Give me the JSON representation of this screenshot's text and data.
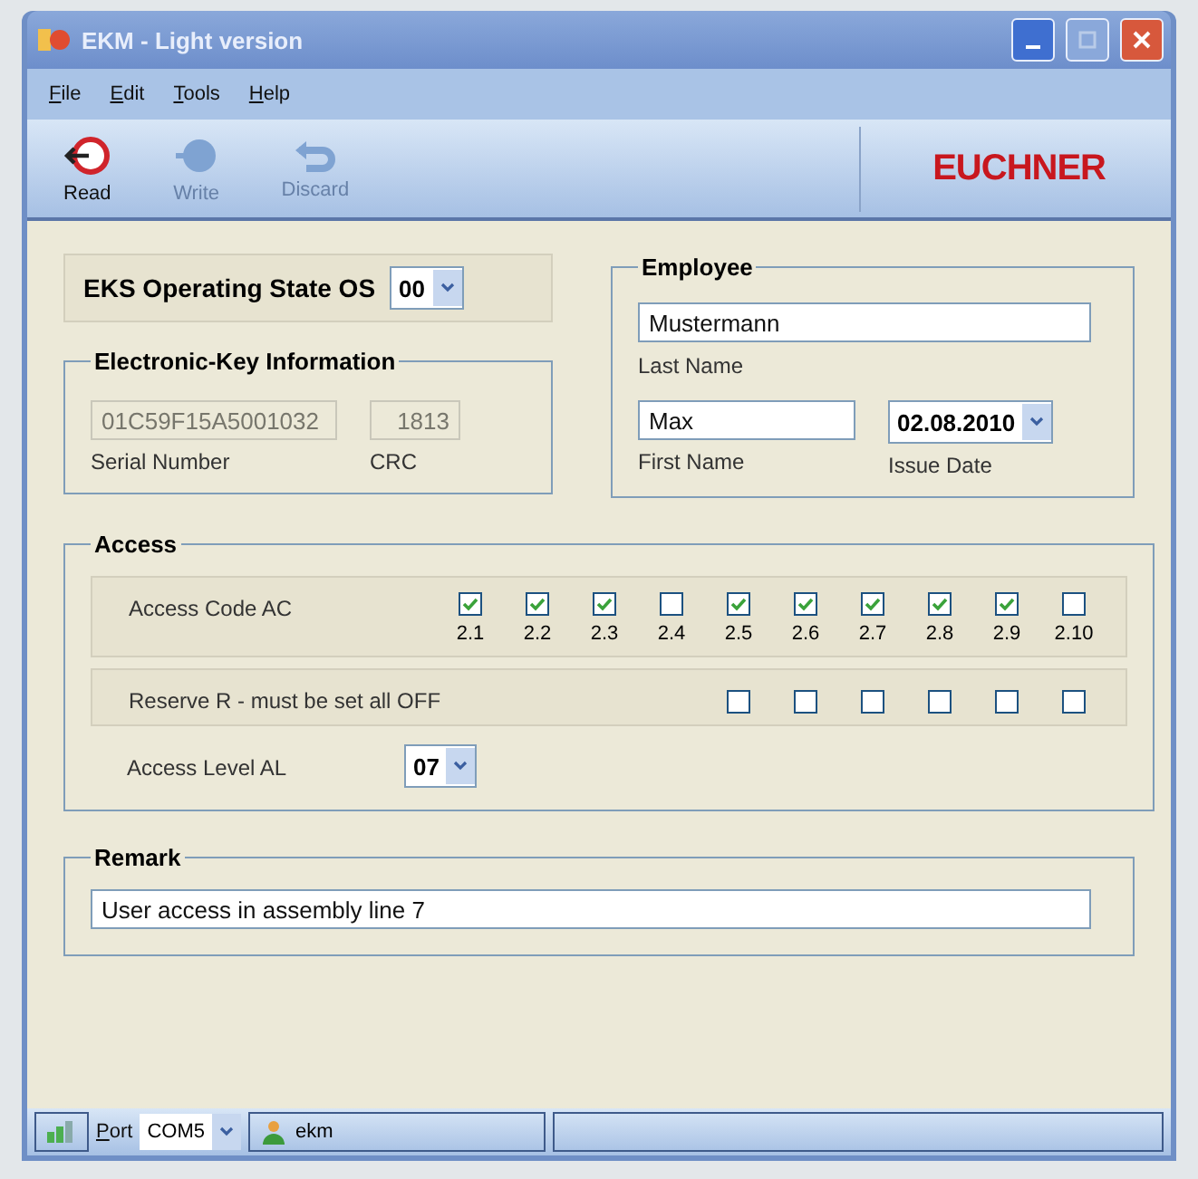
{
  "window": {
    "title": "EKM - Light version"
  },
  "menu": [
    {
      "label": "File"
    },
    {
      "label": "Edit"
    },
    {
      "label": "Tools"
    },
    {
      "label": "Help"
    }
  ],
  "toolbar": {
    "buttons": [
      {
        "kind": "read",
        "label": "Read",
        "disabled": false
      },
      {
        "kind": "write",
        "label": "Write",
        "disabled": true
      },
      {
        "kind": "discard",
        "label": "Discard",
        "disabled": true
      }
    ],
    "logo": "EUCHNER"
  },
  "operating_state": {
    "label": "EKS Operating State OS",
    "value": "00"
  },
  "key_info": {
    "title": "Electronic-Key Information",
    "serial": {
      "value": "01C59F15A5001032",
      "label": "Serial Number"
    },
    "crc": {
      "value": "1813",
      "label": "CRC"
    }
  },
  "employee": {
    "title": "Employee",
    "last_name": {
      "value": "Mustermann",
      "label": "Last Name"
    },
    "first_name": {
      "value": "Max",
      "label": "First Name"
    },
    "issue_date": {
      "value": "02.08.2010",
      "label": "Issue Date"
    }
  },
  "access": {
    "title": "Access",
    "code": {
      "label": "Access Code AC",
      "items": [
        {
          "label": "2.1",
          "checked": true
        },
        {
          "label": "2.2",
          "checked": true
        },
        {
          "label": "2.3",
          "checked": true
        },
        {
          "label": "2.4",
          "checked": false
        },
        {
          "label": "2.5",
          "checked": true
        },
        {
          "label": "2.6",
          "checked": true
        },
        {
          "label": "2.7",
          "checked": true
        },
        {
          "label": "2.8",
          "checked": true
        },
        {
          "label": "2.9",
          "checked": true
        },
        {
          "label": "2.10",
          "checked": false
        }
      ]
    },
    "reserve": {
      "label": "Reserve R - must be set all OFF",
      "items": [
        {
          "checked": false
        },
        {
          "checked": false
        },
        {
          "checked": false
        },
        {
          "checked": false
        },
        {
          "checked": false
        },
        {
          "checked": false
        }
      ]
    },
    "level": {
      "label": "Access Level AL",
      "value": "07"
    }
  },
  "remark": {
    "title": "Remark",
    "value": "User access in assembly line 7"
  },
  "status_bar": {
    "port_label": "Port",
    "port": "COM5",
    "user": "ekm"
  }
}
